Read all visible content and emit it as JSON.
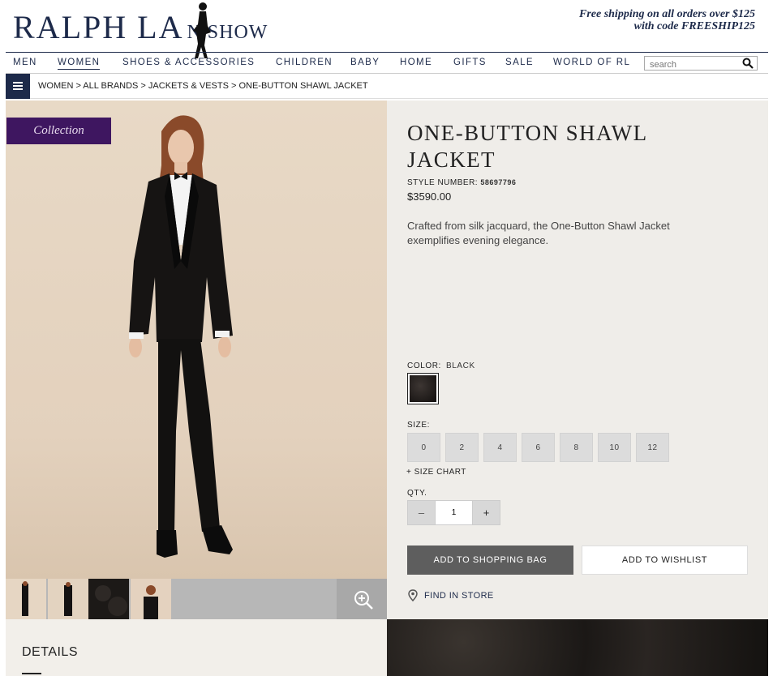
{
  "header": {
    "logo_main": "RALPH LA",
    "logo_sub": "N SHOW",
    "promo_line1": "Free shipping on all orders over $125",
    "promo_line2": "with code FREESHIP125"
  },
  "nav": {
    "items": [
      {
        "label": "MEN"
      },
      {
        "label": "WOMEN"
      },
      {
        "label": "SHOES & ACCESSORIES"
      },
      {
        "label": "CHILDREN"
      },
      {
        "label": "BABY"
      },
      {
        "label": "HOME"
      },
      {
        "label": "GIFTS"
      },
      {
        "label": "SALE"
      },
      {
        "label": "WORLD OF RL"
      }
    ],
    "active": "WOMEN",
    "search_placeholder": "search"
  },
  "breadcrumb": {
    "text": "WOMEN > ALL BRANDS > JACKETS & VESTS > ONE-BUTTON SHAWL JACKET"
  },
  "product": {
    "badge": "Collection",
    "title": "ONE-BUTTON SHAWL JACKET",
    "style_label": "STYLE NUMBER:",
    "style_number": "58697796",
    "price": "$3590.00",
    "description": "Crafted from silk jacquard, the One-Button Shawl Jacket exemplifies evening elegance.",
    "color_label": "COLOR:",
    "color_value": "BLACK",
    "size_label": "SIZE:",
    "sizes": [
      "0",
      "2",
      "4",
      "6",
      "8",
      "10",
      "12"
    ],
    "size_chart": "+ SIZE CHART",
    "qty_label": "QTY.",
    "qty_value": "1",
    "qty_minus": "–",
    "qty_plus": "+",
    "add_to_bag": "ADD TO SHOPPING BAG",
    "add_to_wishlist": "ADD TO WISHLIST",
    "find_in_store": "FIND IN STORE"
  },
  "details": {
    "title": "DETAILS"
  },
  "colors": {
    "brand_navy": "#1d2a4a",
    "collection_purple": "#3e1660",
    "bag_button": "#5e5e5e",
    "panel_bg": "#efede9"
  }
}
